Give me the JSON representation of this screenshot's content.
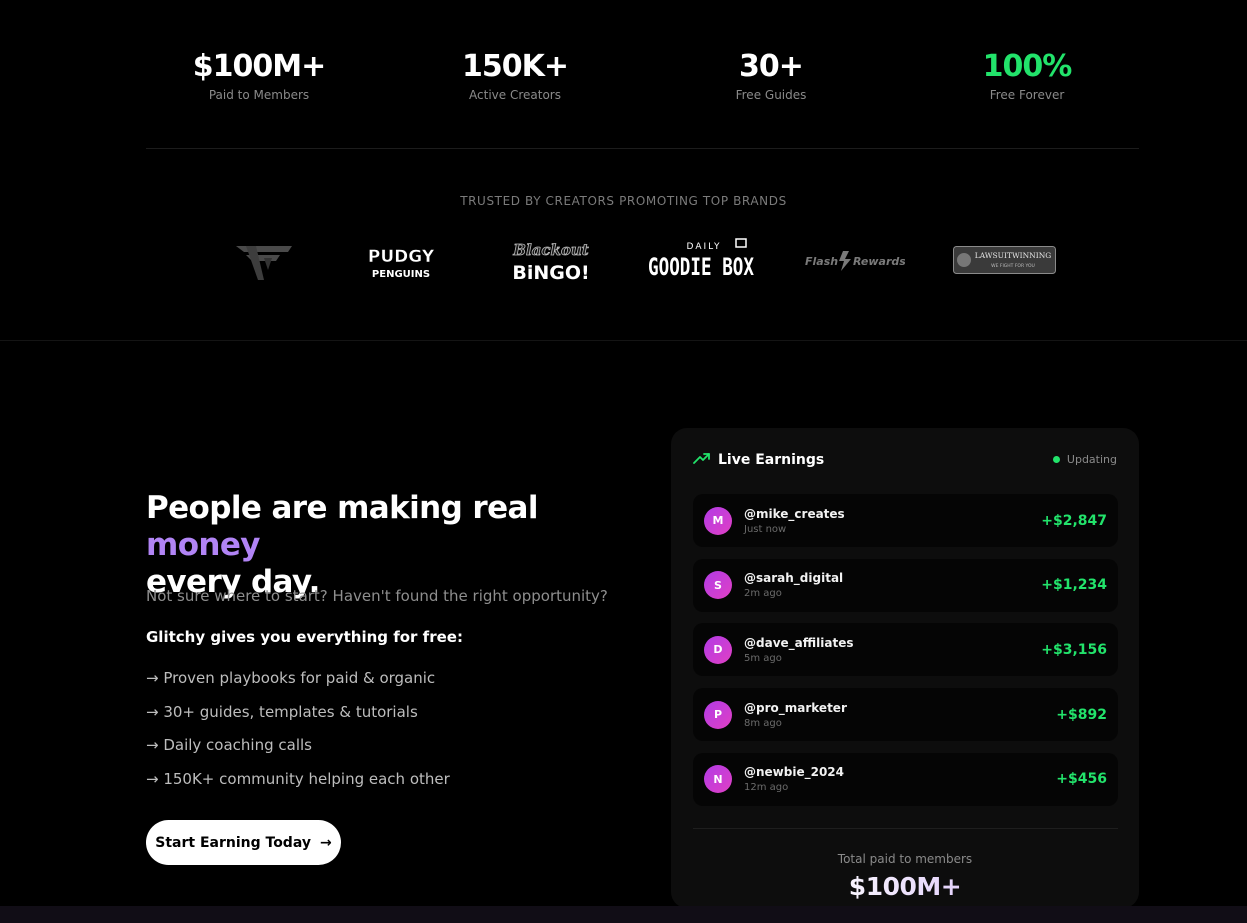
{
  "stats": [
    {
      "value": "$100M+",
      "label": "Paid to Members"
    },
    {
      "value": "150K+",
      "label": "Active Creators"
    },
    {
      "value": "30+",
      "label": "Free Guides"
    },
    {
      "value": "100%",
      "label": "Free Forever"
    }
  ],
  "trusted": {
    "label": "TRUSTED BY CREATORS PROMOTING TOP BRANDS",
    "brands": [
      "FaZe",
      "Pudgy Penguins",
      "Blackout Bingo",
      "Daily Goodie Box",
      "Flash Rewards",
      "LawsuitWinning"
    ]
  },
  "hero": {
    "headline_part1": "People are making real ",
    "headline_accent": "money",
    "headline_part2": "every day.",
    "subtext": "Not sure where to start? Haven't found the right opportunity?",
    "give_line": "Glitchy gives you everything for free:",
    "features": [
      "→ Proven playbooks for paid & organic",
      "→ 30+ guides, templates & tutorials",
      "→ Daily coaching calls",
      "→ 150K+ community helping each other"
    ],
    "cta_label": "Start Earning Today",
    "cta_arrow": "→"
  },
  "live": {
    "title": "Live Earnings",
    "status": "Updating",
    "entries": [
      {
        "initial": "M",
        "handle": "@mike_creates",
        "time": "Just now",
        "amount": "+$2,847"
      },
      {
        "initial": "S",
        "handle": "@sarah_digital",
        "time": "2m ago",
        "amount": "+$1,234"
      },
      {
        "initial": "D",
        "handle": "@dave_affiliates",
        "time": "5m ago",
        "amount": "+$3,156"
      },
      {
        "initial": "P",
        "handle": "@pro_marketer",
        "time": "8m ago",
        "amount": "+$892"
      },
      {
        "initial": "N",
        "handle": "@newbie_2024",
        "time": "12m ago",
        "amount": "+$456"
      }
    ],
    "total_label": "Total paid to members",
    "total_value": "$100M+"
  },
  "colors": {
    "accent_purple": "#b184f5",
    "positive_green": "#22e36b"
  }
}
